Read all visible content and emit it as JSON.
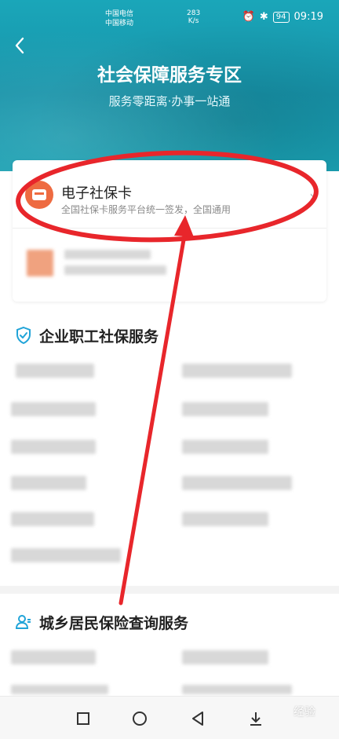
{
  "status_bar": {
    "carrier1": "中国电信",
    "carrier2": "中国移动",
    "net_speed_value": "283",
    "net_speed_unit": "K/s",
    "battery": "94",
    "time": "09:19"
  },
  "header": {
    "title": "社会保障服务专区",
    "subtitle": "服务零距离·办事一站通"
  },
  "social_security_card": {
    "title": "电子社保卡",
    "description": "全国社保卡服务平台统一签发，全国通用"
  },
  "sections": {
    "enterprise": {
      "title": "企业职工社保服务"
    },
    "resident": {
      "title": "城乡居民保险查询服务"
    }
  },
  "watermark": "经验",
  "colors": {
    "header": "#1793a9",
    "accent_orange": "#ee6b41",
    "annotation_red": "#e8262b",
    "section_icon": "#21a4d8"
  },
  "icons": {
    "back": "chevron-left-icon",
    "card": "card-icon",
    "shield": "shield-check-icon",
    "person": "person-icon"
  }
}
